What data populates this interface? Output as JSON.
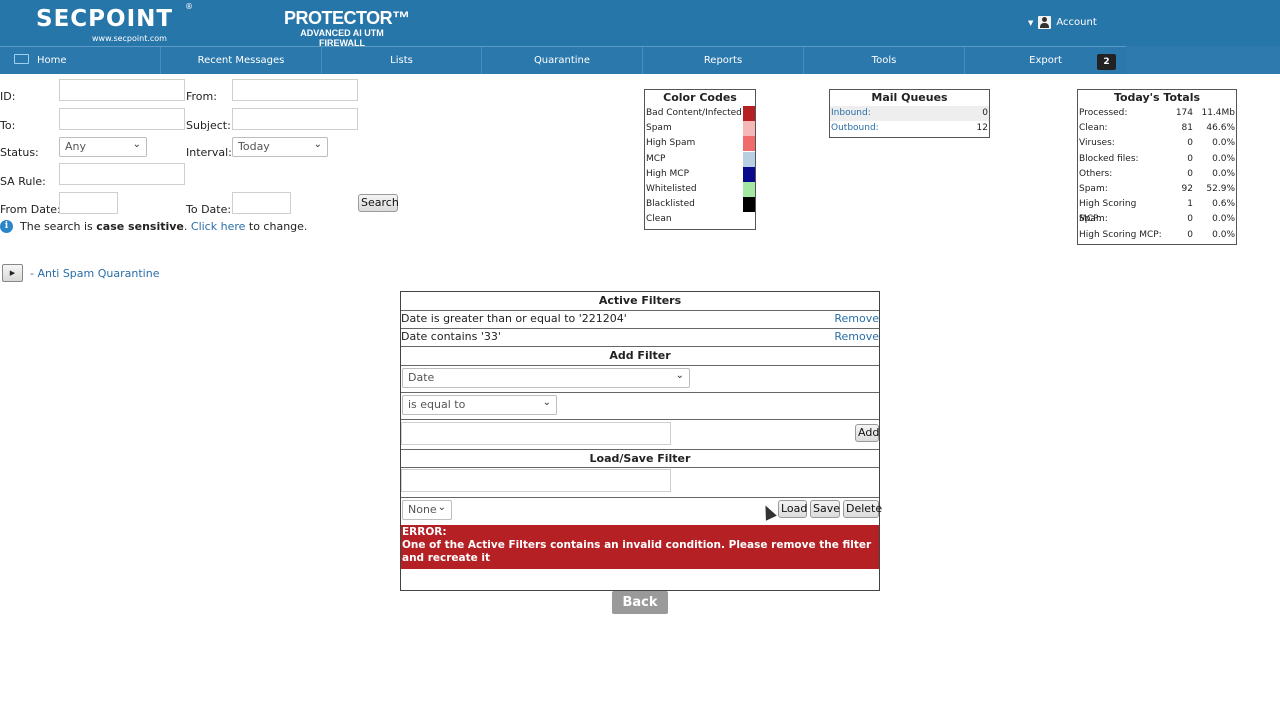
{
  "header": {
    "logo_text": "SECPOINT",
    "logo_reg": "®",
    "logo_url": "www.secpoint.com",
    "product_title": "PROTECTOR™",
    "product_subtitle": "ADVANCED AI UTM FIREWALL",
    "account_label": "Account"
  },
  "nav": {
    "items": [
      "Home",
      "Recent Messages",
      "Lists",
      "Quarantine",
      "Reports",
      "Tools",
      "Export"
    ],
    "badge": "2"
  },
  "search_form": {
    "id_label": "ID:",
    "from_label": "From:",
    "to_label": "To:",
    "subject_label": "Subject:",
    "status_label": "Status:",
    "status_value": "Any",
    "interval_label": "Interval:",
    "interval_value": "Today",
    "sa_rule_label": "SA Rule:",
    "from_date_label": "From Date:",
    "to_date_label": "To Date:",
    "search_button": "Search",
    "info_prefix": "The search is",
    "info_bold": "case sensitive",
    "info_dot": ".",
    "info_link": "Click here",
    "info_suffix": "to change."
  },
  "color_codes": {
    "title": "Color Codes",
    "items": [
      {
        "label": "Bad Content/Infected",
        "color": "#b52025"
      },
      {
        "label": "Spam",
        "color": "#f5b8b8"
      },
      {
        "label": "High Spam",
        "color": "#f06b6b"
      },
      {
        "label": "MCP",
        "color": "#b7cfe0"
      },
      {
        "label": "High MCP",
        "color": "#0a0a8c"
      },
      {
        "label": "Whitelisted",
        "color": "#a2e8a2"
      },
      {
        "label": "Blacklisted",
        "color": "#000000"
      },
      {
        "label": "Clean",
        "color": "#ffffff"
      }
    ]
  },
  "mail_queues": {
    "title": "Mail Queues",
    "items": [
      {
        "label": "Inbound:",
        "value": "0"
      },
      {
        "label": "Outbound:",
        "value": "12"
      }
    ]
  },
  "totals": {
    "title": "Today's Totals",
    "rows": [
      {
        "label": "Processed:",
        "value": "174",
        "pct": "11.4Mb"
      },
      {
        "label": "Clean:",
        "value": "81",
        "pct": "46.6%"
      },
      {
        "label": "Viruses:",
        "value": "0",
        "pct": "0.0%"
      },
      {
        "label": "Blocked files:",
        "value": "0",
        "pct": "0.0%"
      },
      {
        "label": "Others:",
        "value": "0",
        "pct": "0.0%"
      },
      {
        "label": "Spam:",
        "value": "92",
        "pct": "52.9%"
      },
      {
        "label": "High Scoring Spam:",
        "value": "1",
        "pct": "0.6%"
      },
      {
        "label": "MCP:",
        "value": "0",
        "pct": "0.0%"
      },
      {
        "label": "High Scoring MCP:",
        "value": "0",
        "pct": "0.0%"
      }
    ]
  },
  "quarantine_toggle": {
    "play_symbol": "▶",
    "label": "- Anti Spam Quarantine"
  },
  "filters": {
    "active_title": "Active Filters",
    "active": [
      {
        "text": "Date is greater than or equal to '221204'",
        "action": "Remove"
      },
      {
        "text": "Date contains '33'",
        "action": "Remove"
      }
    ],
    "add_title": "Add Filter",
    "field_value": "Date",
    "operator_value": "is equal to",
    "add_button": "Add",
    "loadsave_title": "Load/Save Filter",
    "saved_value": "None",
    "load_button": "Load",
    "save_button": "Save",
    "delete_button": "Delete",
    "error_title": "ERROR:",
    "error_message": "One of the Active Filters contains an invalid condition. Please remove the filter and recreate it"
  },
  "back_button": "Back"
}
